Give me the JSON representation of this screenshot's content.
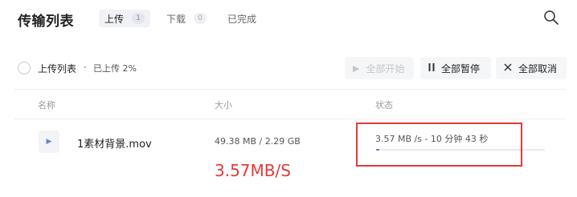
{
  "header": {
    "title": "传输列表",
    "tabs": [
      {
        "label": "上传",
        "count": "1",
        "active": true
      },
      {
        "label": "下载",
        "count": "0",
        "active": false
      },
      {
        "label": "已完成",
        "count": "",
        "active": false
      }
    ],
    "search_icon": "search-icon"
  },
  "toolbar": {
    "list_title": "上传列表",
    "separator": "·",
    "status": "已上传 2%",
    "buttons": {
      "start_all": {
        "label": "全部开始",
        "icon": "play-icon",
        "enabled": false
      },
      "pause_all": {
        "label": "全部暂停",
        "icon": "pause-icon",
        "enabled": true
      },
      "cancel_all": {
        "label": "全部取消",
        "icon": "close-icon",
        "enabled": true
      }
    }
  },
  "table": {
    "columns": [
      "名称",
      "大小",
      "状态"
    ],
    "rows": [
      {
        "name": "1素材背景.mov",
        "size": "49.38 MB / 2.29 GB",
        "status": "3.57 MB /s - 10 分钟 43 秒",
        "progress": 0.02,
        "icon": "video-file-icon"
      }
    ]
  },
  "annotation": {
    "text": "3.57MB/S",
    "color": "#e53935"
  },
  "colors": {
    "accent": "#5b6ee1",
    "highlight": "#e53935"
  }
}
